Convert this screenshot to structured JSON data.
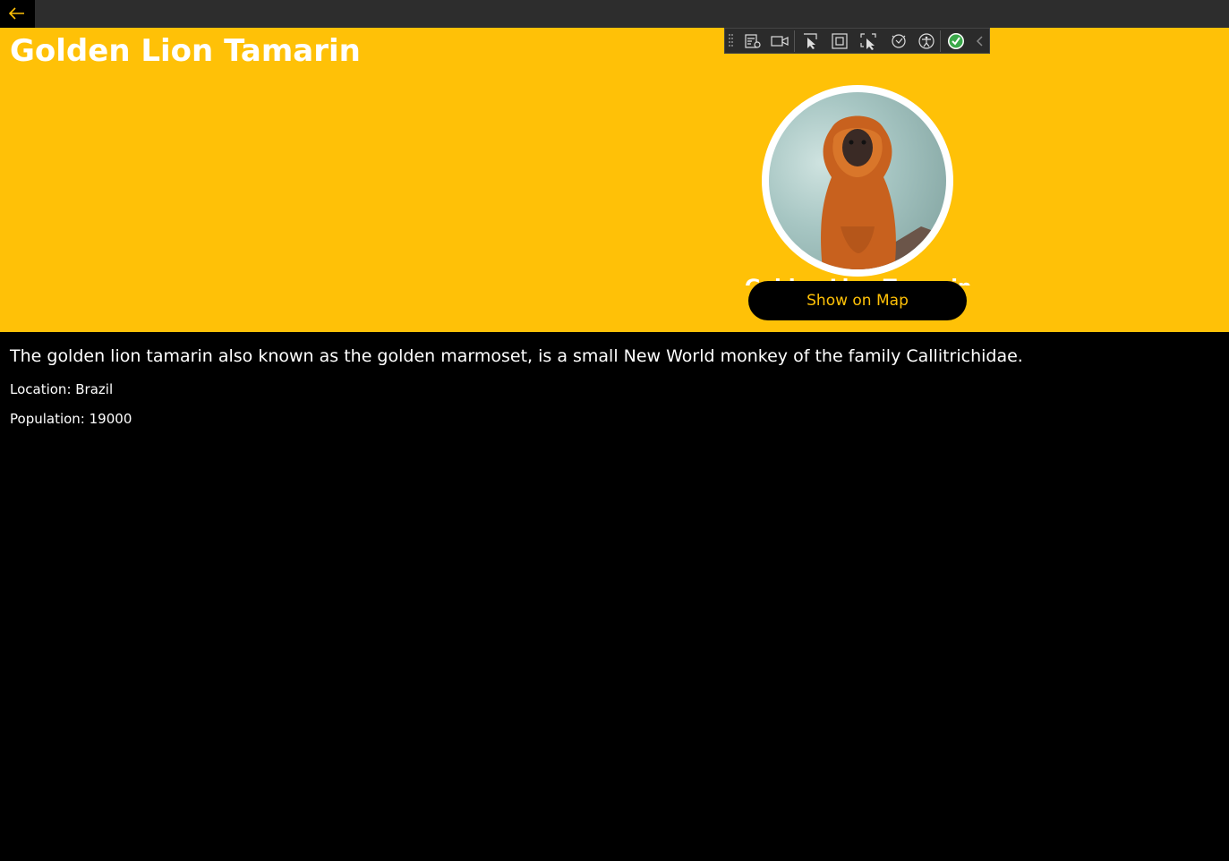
{
  "titlebar": {
    "back_icon": "arrow-left-icon",
    "accent_color": "#FFC107"
  },
  "header": {
    "title": "Golden Lion Tamarin",
    "background_color": "#FFC107",
    "avatar_icon": "animal-photo",
    "overlapped_name": "Golden Lion Tamarin",
    "map_button_label": "Show on Map"
  },
  "debug_toolbar": {
    "icons": [
      "grip-icon",
      "visual-tree-icon",
      "record-icon",
      "select-element-icon",
      "display-layout-adorners-icon",
      "track-focus-icon",
      "hot-reload-icon",
      "accessibility-icon",
      "check-circle-icon",
      "collapse-chevron-icon"
    ]
  },
  "details": {
    "description": "The golden lion tamarin also known as the golden marmoset, is a small New World monkey of the family Callitrichidae.",
    "location_label": "Location: ",
    "location_value": "Brazil",
    "population_label": "Population: ",
    "population_value": "19000"
  }
}
